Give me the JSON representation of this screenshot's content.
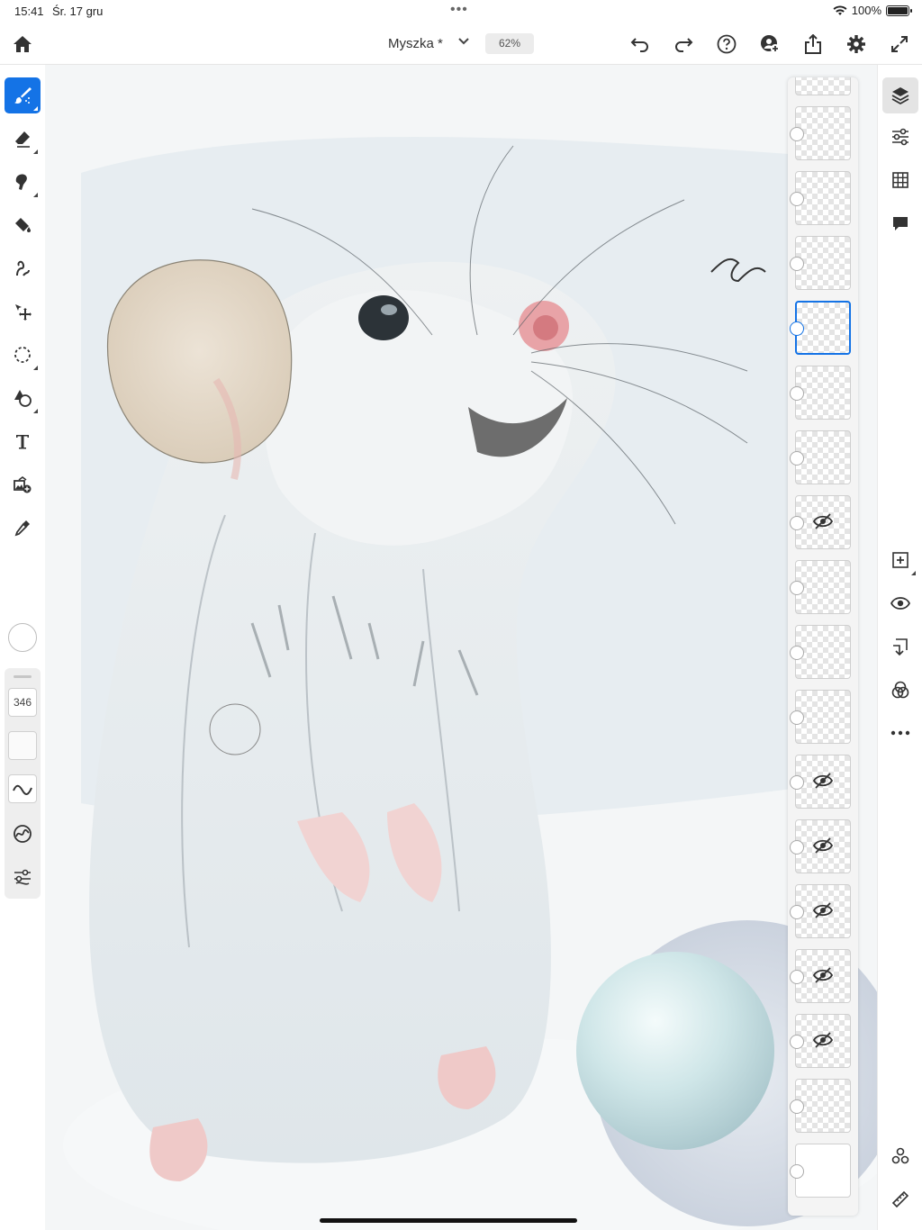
{
  "status_bar": {
    "time": "15:41",
    "date": "Śr. 17 gru",
    "battery": "100%"
  },
  "document": {
    "title": "Myszka *",
    "zoom": "62%"
  },
  "left_tools": [
    {
      "id": "brush",
      "icon": "brush-icon",
      "active": true
    },
    {
      "id": "eraser",
      "icon": "eraser-icon"
    },
    {
      "id": "smudge",
      "icon": "smudge-icon"
    },
    {
      "id": "fill",
      "icon": "paint-bucket-icon"
    },
    {
      "id": "liquify",
      "icon": "liquify-icon"
    },
    {
      "id": "transform",
      "icon": "move-icon"
    },
    {
      "id": "selection",
      "icon": "lasso-icon"
    },
    {
      "id": "shapes",
      "icon": "shapes-icon"
    },
    {
      "id": "text",
      "icon": "text-icon"
    },
    {
      "id": "place-image",
      "icon": "add-image-icon"
    },
    {
      "id": "eyedropper",
      "icon": "eyedropper-icon"
    }
  ],
  "brush_settings": {
    "size": "346"
  },
  "layers": [
    {
      "hidden": false,
      "selected": false
    },
    {
      "hidden": false,
      "selected": false
    },
    {
      "hidden": false,
      "selected": false
    },
    {
      "hidden": false,
      "selected": false
    },
    {
      "hidden": false,
      "selected": true
    },
    {
      "hidden": false,
      "selected": false
    },
    {
      "hidden": false,
      "selected": false
    },
    {
      "hidden": true,
      "selected": false
    },
    {
      "hidden": false,
      "selected": false
    },
    {
      "hidden": false,
      "selected": false
    },
    {
      "hidden": false,
      "selected": false
    },
    {
      "hidden": true,
      "selected": false
    },
    {
      "hidden": true,
      "selected": false
    },
    {
      "hidden": true,
      "selected": false
    },
    {
      "hidden": true,
      "selected": false
    },
    {
      "hidden": true,
      "selected": false
    },
    {
      "hidden": false,
      "selected": false
    },
    {
      "hidden": false,
      "selected": false,
      "background": true
    }
  ],
  "colors": {
    "accent": "#1473e6"
  }
}
